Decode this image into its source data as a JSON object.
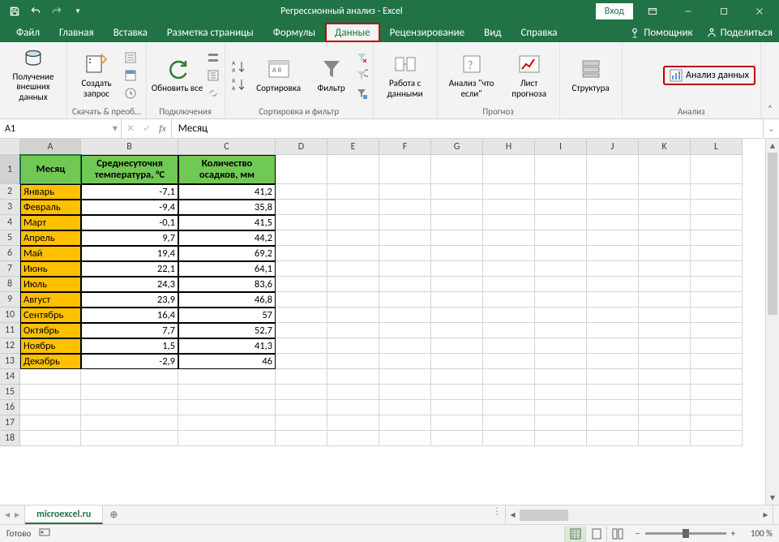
{
  "title": "Регрессионный анализ  -  Excel",
  "login": "Вход",
  "tabs": {
    "file": "Файл",
    "home": "Главная",
    "insert": "Вставка",
    "layout": "Разметка страницы",
    "formulas": "Формулы",
    "data": "Данные",
    "review": "Рецензирование",
    "view": "Вид",
    "help": "Справка",
    "assist": "Помощник",
    "share": "Поделиться"
  },
  "ribbon": {
    "g1": {
      "btn": "Получение внешних данных"
    },
    "g2": {
      "btn": "Создать запрос",
      "label": "Скачать & преоб…"
    },
    "g3": {
      "btn": "Обновить все",
      "label": "Подключения"
    },
    "g4": {
      "az": "А↓Я",
      "za": "Я↓А",
      "sort": "Сортировка",
      "filter": "Фильтр",
      "label": "Сортировка и фильтр"
    },
    "g5": {
      "btn": "Работа с данными"
    },
    "g6": {
      "whatif": "Анализ \"что если\"",
      "forecast": "Лист прогноза",
      "label": "Прогноз"
    },
    "g7": {
      "btn": "Структура"
    },
    "g8": {
      "btn": "Анализ данных",
      "label": "Анализ"
    }
  },
  "namebox": "A1",
  "formula": "Месяц",
  "columns": [
    "A",
    "B",
    "C",
    "D",
    "E",
    "F",
    "G",
    "H",
    "I",
    "J",
    "K",
    "L"
  ],
  "headerRow": {
    "a": "Месяц",
    "b": "Среднесуточня температура, °C",
    "c": "Количество осадков, мм"
  },
  "rows": [
    {
      "a": "Январь",
      "b": "-7,1",
      "c": "41,2"
    },
    {
      "a": "Февраль",
      "b": "-9,4",
      "c": "35,8"
    },
    {
      "a": "Март",
      "b": "-0,1",
      "c": "41,5"
    },
    {
      "a": "Апрель",
      "b": "9,7",
      "c": "44,2"
    },
    {
      "a": "Май",
      "b": "19,4",
      "c": "69,2"
    },
    {
      "a": "Июнь",
      "b": "22,1",
      "c": "64,1"
    },
    {
      "a": "Июль",
      "b": "24,3",
      "c": "83,6"
    },
    {
      "a": "Август",
      "b": "23,9",
      "c": "46,8"
    },
    {
      "a": "Сентябрь",
      "b": "16,4",
      "c": "57"
    },
    {
      "a": "Октябрь",
      "b": "7,7",
      "c": "52,7"
    },
    {
      "a": "Ноябрь",
      "b": "1,5",
      "c": "41,3"
    },
    {
      "a": "Декабрь",
      "b": "-2,9",
      "c": "46"
    }
  ],
  "sheet": "microexcel.ru",
  "status": "Готово",
  "zoom": "100 %"
}
